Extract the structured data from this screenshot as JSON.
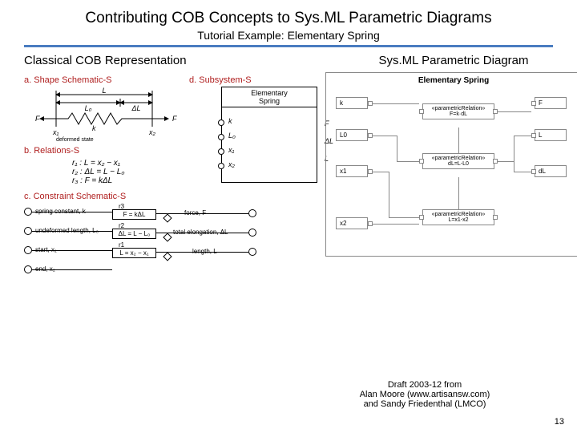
{
  "title": "Contributing COB Concepts to Sys.ML Parametric Diagrams",
  "subtitle": "Tutorial Example: Elementary Spring",
  "left": {
    "heading": "Classical COB Representation",
    "a_label": "a. Shape Schematic-S",
    "b_label": "b. Relations-S",
    "c_label": "c. Constraint Schematic-S",
    "d_label": "d. Subsystem-S",
    "shape": {
      "L": "L",
      "L0": "L₀",
      "dL": "ΔL",
      "F": "F",
      "x1": "x₁",
      "x2": "x₂",
      "k": "k",
      "deformed": "deformed state"
    },
    "relations": {
      "r1": "r₁ : L = x₂ − x₁",
      "r2": "r₂ : ΔL = L − L₀",
      "r3": "r₃ : F = kΔL"
    },
    "constraint": {
      "n1": "spring constant, k",
      "n2": "undeformed length, L₀",
      "n3": "start, x₁",
      "n4": "end, x₂",
      "out1": "force, F",
      "out2": "total elongation, ΔL",
      "out3": "length, L",
      "box1": "F = kΔL",
      "box2": "ΔL = L − L₀",
      "box3": "L = x₂ − x₁",
      "r1": "r1",
      "r2": "r2",
      "r3": "r3"
    },
    "subsystem": {
      "title": "Elementary\nSpring",
      "ports": [
        "k",
        "L₀",
        "x₁",
        "x₂"
      ],
      "outs": [
        "F",
        "ΔL",
        "L"
      ]
    }
  },
  "right": {
    "heading": "Sys.ML Parametric Diagram",
    "frame_title": "Elementary Spring",
    "blocks": {
      "k": "k",
      "L0": "L0",
      "x1": "x1",
      "x2": "x2",
      "F": "F",
      "L": "L",
      "dL": "dL"
    },
    "rels": {
      "r1": "«parametricRelation»\nF=k·dL",
      "r2": "«parametricRelation»\ndL=L-L0",
      "r3": "«parametricRelation»\nL=x1-x2"
    }
  },
  "footer": {
    "line1": "Draft 2003-12 from",
    "line2": "Alan Moore (www.artisansw.com)",
    "line3": "and Sandy Friedenthal (LMCO)"
  },
  "pagenum": "13"
}
